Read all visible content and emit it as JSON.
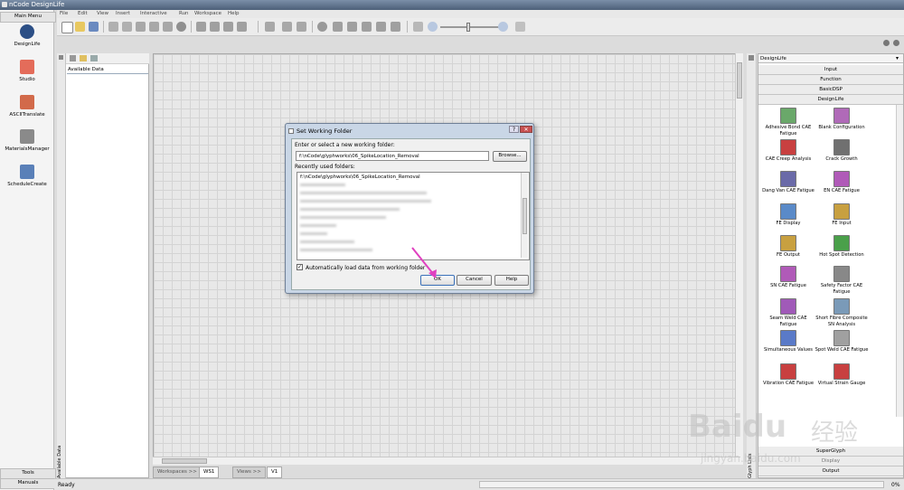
{
  "window": {
    "title": "nCode DesignLife"
  },
  "menubar": [
    "File",
    "Edit",
    "View",
    "Insert",
    "Interactive",
    "Run",
    "Workspace",
    "Help"
  ],
  "main_menu": {
    "header": "Main Menu",
    "items": [
      {
        "label": "DesignLife",
        "icon": "designlife-icon"
      },
      {
        "label": "Studio",
        "icon": "studio-icon"
      },
      {
        "label": "ASCIITranslate",
        "icon": "ascii-translate-icon"
      },
      {
        "label": "MaterialsManager",
        "icon": "materials-manager-icon"
      },
      {
        "label": "ScheduleCreate",
        "icon": "schedule-create-icon"
      }
    ],
    "footer_tools": "Tools",
    "footer_manuals": "Manuals"
  },
  "available_data": {
    "title": "Available Data",
    "side_label": "Available Data"
  },
  "workspace_tabs": {
    "workspaces": "Workspaces >>",
    "ws1": "WS1",
    "views": "Views >>",
    "v1": "V1"
  },
  "status": {
    "text": "Ready",
    "progress": "0%"
  },
  "palette": {
    "dropdown": "DesignLife",
    "side_label": "Glyph Lists",
    "categories_top": [
      "Input",
      "Function",
      "BasicDSP",
      "DesignLife"
    ],
    "glyphs": [
      {
        "label": "Adhesive Bond CAE Fatigue",
        "color": "#6aa86a"
      },
      {
        "label": "Blank Configuration",
        "color": "#b06ab8"
      },
      {
        "label": "CAE Creep Analysis",
        "color": "#c84040"
      },
      {
        "label": "Crack Growth",
        "color": "#707070"
      },
      {
        "label": "Dang Van CAE Fatigue",
        "color": "#6a6aa8"
      },
      {
        "label": "EN CAE Fatigue",
        "color": "#b05ab8"
      },
      {
        "label": "FE Display",
        "color": "#5a8ac8"
      },
      {
        "label": "FE Input",
        "color": "#c8a040"
      },
      {
        "label": "FE Output",
        "color": "#c8a040"
      },
      {
        "label": "Hot Spot Detection",
        "color": "#4aa04a"
      },
      {
        "label": "SN CAE Fatigue",
        "color": "#b05ab8"
      },
      {
        "label": "Safety Factor CAE Fatigue",
        "color": "#888888"
      },
      {
        "label": "Seam Weld CAE Fatigue",
        "color": "#a05ab8"
      },
      {
        "label": "Short Fibre Composite SN Analysis",
        "color": "#7a9ab8"
      },
      {
        "label": "Simultaneous Values",
        "color": "#5a7ac8"
      },
      {
        "label": "Spot Weld CAE Fatigue",
        "color": "#a0a0a0"
      },
      {
        "label": "Vibration CAE Fatigue",
        "color": "#c84040"
      },
      {
        "label": "Virtual Strain Gauge",
        "color": "#c84040"
      }
    ],
    "categories_bottom": [
      "SuperGlyph",
      "Display",
      "Output"
    ]
  },
  "dialog": {
    "title": "Set Working Folder",
    "prompt": "Enter or select a new working folder:",
    "path_value": "f:\\nCode\\glyphworks\\06_SpikeLocation_Removal",
    "browse": "Browse...",
    "recent_label": "Recently used folders:",
    "recent_first": "f:\\nCode\\glyphworks\\06_SpikeLocation_Removal",
    "checkbox_label": "Automatically load data from working folder",
    "checkbox_checked": true,
    "ok": "OK",
    "cancel": "Cancel",
    "help": "Help"
  },
  "watermark": {
    "brand": "Baidu",
    "cn": "经验",
    "url": "jingyan.baidu.com"
  }
}
